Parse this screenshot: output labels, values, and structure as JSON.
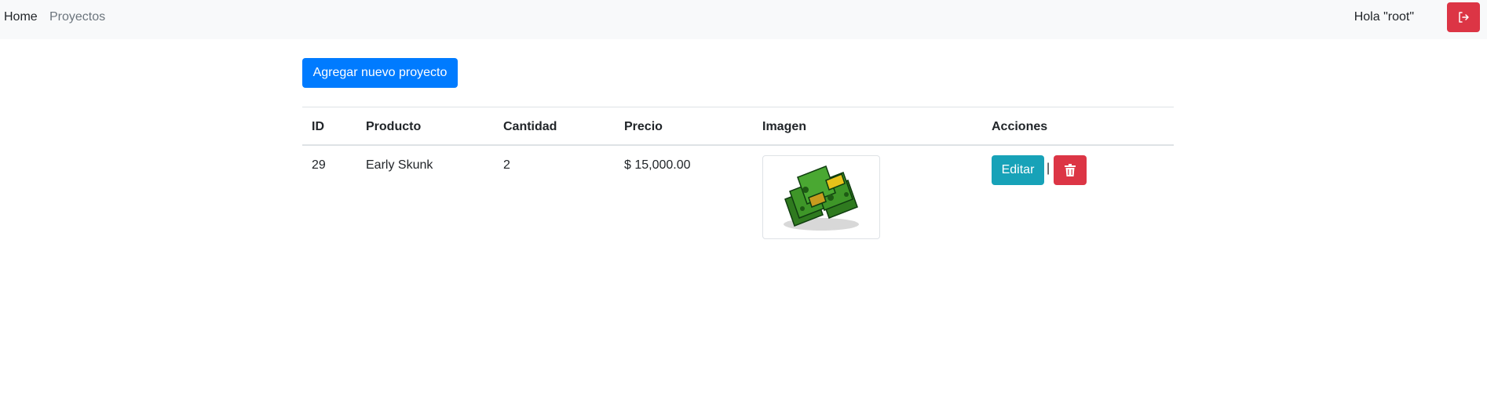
{
  "navbar": {
    "home_label": "Home",
    "projects_label": "Proyectos",
    "greeting": "Hola \"root\"",
    "logout_icon": "logout-icon"
  },
  "main": {
    "add_button_label": "Agregar nuevo proyecto"
  },
  "table": {
    "headers": [
      "ID",
      "Producto",
      "Cantidad",
      "Precio",
      "Imagen",
      "Acciones"
    ],
    "rows": [
      {
        "id": "29",
        "producto": "Early Skunk",
        "cantidad": "2",
        "precio": "$ 15,000.00",
        "image_icon": "money-stack-icon",
        "edit_label": "Editar",
        "separator": "|",
        "delete_icon": "trash-icon"
      }
    ]
  },
  "colors": {
    "primary": "#007bff",
    "danger": "#dc3545",
    "info": "#17a2b8",
    "navbar_bg": "#f8f9fa"
  }
}
